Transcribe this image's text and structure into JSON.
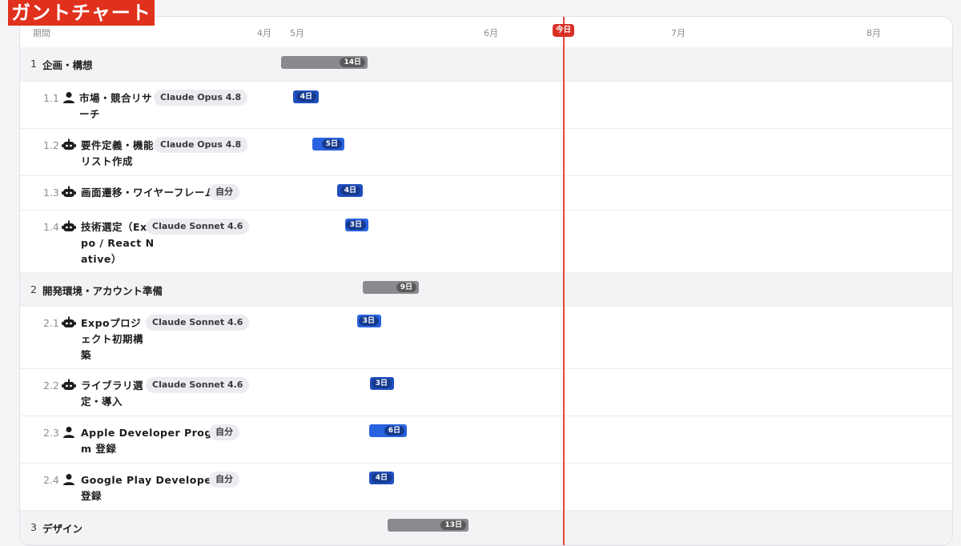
{
  "title": "ガントチャート",
  "header": {
    "period_label": "期間",
    "months": [
      "4月",
      "5月",
      "6月",
      "7月",
      "8月"
    ],
    "today_label": "今日"
  },
  "groups": [
    {
      "num": "1",
      "name": "企画・構想",
      "duration": "14日",
      "tasks": [
        {
          "num": "1.1",
          "owner_icon": "person-icon",
          "name_lines": [
            "市場・競合リサ",
            "ーチ"
          ],
          "assignee": "Claude Opus 4.8",
          "duration": "4日"
        },
        {
          "num": "1.2",
          "owner_icon": "robot-icon",
          "name_lines": [
            "要件定義・機能",
            "リスト作成"
          ],
          "assignee": "Claude Opus 4.8",
          "duration": "5日"
        },
        {
          "num": "1.3",
          "owner_icon": "robot-icon",
          "name_lines": [
            "画面遷移・ワイヤーフレーム"
          ],
          "assignee": "自分",
          "duration": "4日"
        },
        {
          "num": "1.4",
          "owner_icon": "robot-icon",
          "name_lines": [
            "技術選定（Ex",
            "po / React N",
            "ative）"
          ],
          "assignee": "Claude Sonnet 4.6",
          "duration": "3日"
        }
      ]
    },
    {
      "num": "2",
      "name": "開発環境・アカウント準備",
      "duration": "9日",
      "tasks": [
        {
          "num": "2.1",
          "owner_icon": "robot-icon",
          "name_lines": [
            "Expoプロジ",
            "ェクト初期構",
            "築"
          ],
          "assignee": "Claude Sonnet 4.6",
          "duration": "3日"
        },
        {
          "num": "2.2",
          "owner_icon": "robot-icon",
          "name_lines": [
            "ライブラリ選",
            "定・導入"
          ],
          "assignee": "Claude Sonnet 4.6",
          "duration": "3日"
        },
        {
          "num": "2.3",
          "owner_icon": "person-icon",
          "name_lines": [
            "Apple Developer Progra",
            "m 登録"
          ],
          "assignee": "自分",
          "duration": "6日"
        },
        {
          "num": "2.4",
          "owner_icon": "person-icon",
          "name_lines": [
            "Google Play Developer",
            "登録"
          ],
          "assignee": "自分",
          "duration": "4日"
        }
      ]
    },
    {
      "num": "3",
      "name": "デザイン",
      "duration": "13日",
      "tasks": []
    }
  ]
}
